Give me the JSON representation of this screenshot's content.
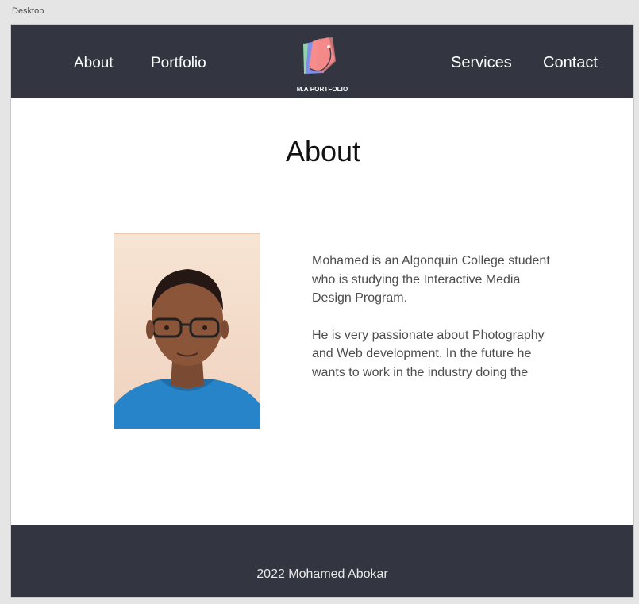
{
  "canvas": {
    "artboard_label": "Desktop"
  },
  "nav": {
    "links": [
      {
        "label": "About"
      },
      {
        "label": "Portfolio"
      },
      {
        "label": "Services"
      },
      {
        "label": "Contact"
      }
    ],
    "logo_text": "M.A PORTFOLIO",
    "background_color": "#333640"
  },
  "main": {
    "title": "About",
    "photo_icon": "profile-photo",
    "bio_paragraphs": [
      "Mohamed is an Algonquin College student who is studying the Interactive Media Design Program.",
      "He is very passionate about Photography and Web development. In the future he wants to work in the industry doing the"
    ]
  },
  "footer": {
    "text": "2022 Mohamed Abokar",
    "background_color": "#333640"
  }
}
